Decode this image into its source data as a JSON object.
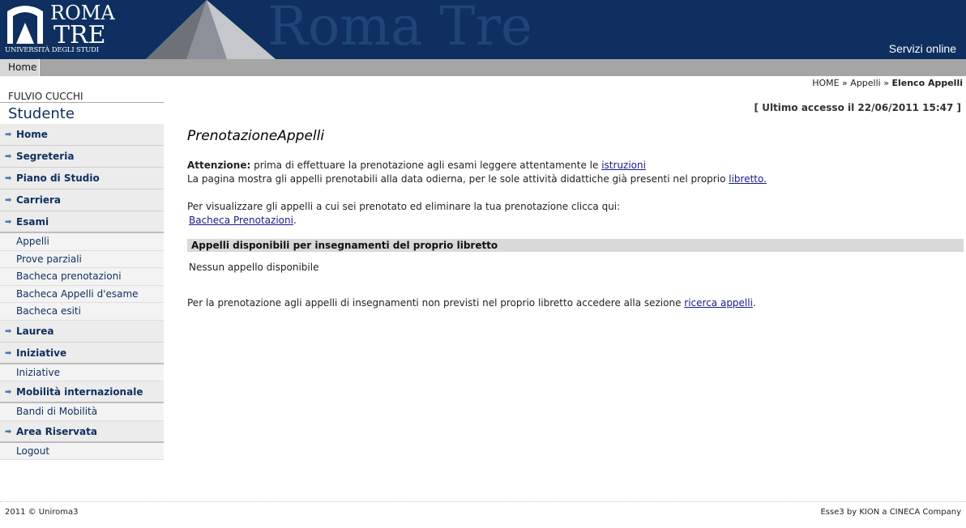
{
  "header": {
    "logo_roma": "ROMA",
    "logo_tre": "TRE",
    "logo_university": "UNIVERSITÀ DEGLI STUDI",
    "watermark": "Roma Tre",
    "servizi": "Servizi online"
  },
  "topnav": {
    "home": "Home"
  },
  "breadcrumb": {
    "home": "HOME",
    "sep1": " » ",
    "appelli": "Appelli",
    "sep2": " » ",
    "current": "Elenco Appelli"
  },
  "last_access": "[ Ultimo accesso il 22/06/2011 15:47 ]",
  "sidebar": {
    "user": "FULVIO CUCCHI",
    "role": "Studente",
    "items": {
      "home": "Home",
      "segreteria": "Segreteria",
      "piano": "Piano di Studio",
      "carriera": "Carriera",
      "esami": "Esami",
      "appelli": "Appelli",
      "prove": "Prove parziali",
      "bacheca_pren": "Bacheca prenotazioni",
      "bacheca_appelli": "Bacheca Appelli d'esame",
      "bacheca_esiti": "Bacheca esiti",
      "laurea": "Laurea",
      "iniziative": "Iniziative",
      "iniziative_sub": "Iniziative",
      "mobilita": "Mobilità internazionale",
      "bandi": "Bandi di Mobilità",
      "area": "Area Riservata",
      "logout": "Logout"
    },
    "arrow_icon": "➡"
  },
  "main": {
    "title": "PrenotazioneAppelli",
    "attention_label": "Attenzione:",
    "attention_text": " prima di effettuare la prenotazione agli esami leggere attentamente le ",
    "istruzioni_link": "istruzioni",
    "line2_text": "La pagina mostra gli appelli prenotabili alla data odierna, per le sole attività didattiche già presenti nel proprio ",
    "libretto_link": "libretto.",
    "line3_text": "Per visualizzare gli appelli a cui sei prenotato ed eliminare la tua prenotazione clicca qui:",
    "bacheca_link": "Bacheca Prenotazioni",
    "bacheca_dot": ".",
    "section_header": "Appelli disponibili per insegnamenti del proprio libretto",
    "empty_message": "Nessun appello disponibile",
    "final_text": "Per la prenotazione agli appelli di insegnamenti non previsti nel proprio libretto accedere alla sezione ",
    "ricerca_link": "ricerca appelli",
    "final_dot": "."
  },
  "footer": {
    "left": "2011 © Uniroma3",
    "right": "Esse3 by KION a CINECA Company"
  },
  "colors": {
    "header_bg": "#0e2f5f",
    "nav_bg": "#a5a5a5",
    "link": "#1a1a8c",
    "section_bg": "#d9d9d9"
  }
}
